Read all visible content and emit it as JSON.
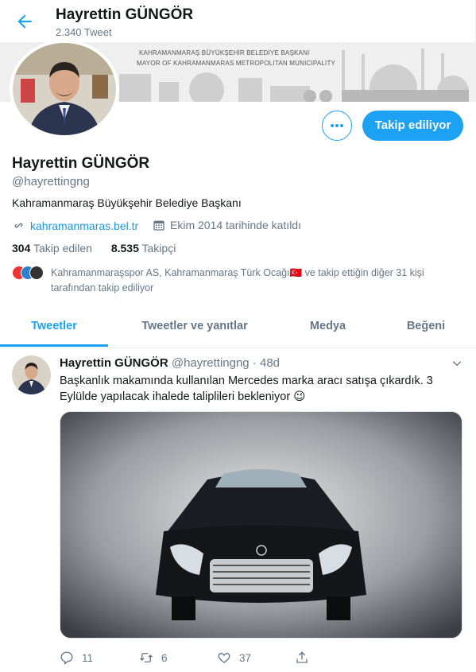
{
  "topbar": {
    "name": "Hayrettin GÜNGÖR",
    "tweet_count": "2.340 Tweet"
  },
  "banner": {
    "line1": "KAHRAMANMARAŞ BÜYÜKŞEHİR BELEDİYE BAŞKANI",
    "line2": "MAYOR OF KAHRAMANMARAS METROPOLITAN MUNICIPALITY"
  },
  "profile": {
    "follow_button": "Takip ediliyor",
    "name": "Hayrettin GÜNGÖR",
    "handle": "@hayrettingng",
    "bio": "Kahramanmaraş Büyükşehir Belediye Başkanı",
    "website": "kahramanmaras.bel.tr",
    "joined": "Ekim 2014 tarihinde katıldı",
    "following_count": "304",
    "following_label": "Takip edilen",
    "followers_count": "8.535",
    "followers_label": "Takipçi",
    "followed_by_line1": "Kahramanmaraşspor AS, Kahramanmaraş Türk Ocağı🇹🇷 ve takip ettiğin diğer 31 kişi",
    "followed_by_line2": "tarafından takip ediliyor"
  },
  "tabs": [
    {
      "label": "Tweetler",
      "active": true
    },
    {
      "label": "Tweetler ve yanıtlar",
      "active": false
    },
    {
      "label": "Medya",
      "active": false
    },
    {
      "label": "Beğeni",
      "active": false
    }
  ],
  "tweet": {
    "author_name": "Hayrettin GÜNGÖR",
    "author_handle": "@hayrettingng · 48d",
    "text": "Başkanlık makamında kullanılan Mercedes marka aracı satışa çıkardık. 3 Eylülde yapılacak ihalede taliplileri bekleniyor 😉",
    "replies": "11",
    "retweets": "6",
    "likes": "37"
  },
  "colors": {
    "accent": "#1da1f2",
    "muted": "#657786",
    "text": "#14171a"
  },
  "icons": [
    "back-arrow-icon",
    "more-dots-icon",
    "link-icon",
    "calendar-icon",
    "caret-down-icon",
    "reply-icon",
    "retweet-icon",
    "like-icon",
    "share-icon"
  ]
}
